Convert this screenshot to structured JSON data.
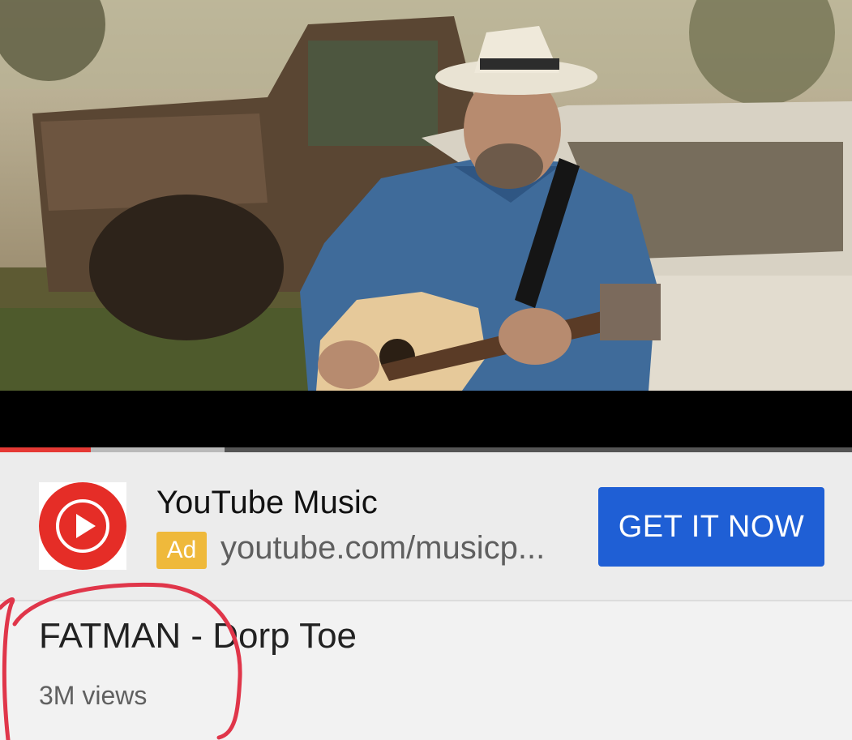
{
  "ad": {
    "title": "YouTube Music",
    "badge": "Ad",
    "url": "youtube.com/musicp...",
    "cta_label": "GET IT NOW"
  },
  "video": {
    "title": "FATMAN - Dorp Toe",
    "views": "3M views",
    "progress_played_fraction": 0.107,
    "progress_buffered_fraction": 0.264
  },
  "colors": {
    "progress_played": "#e53935",
    "cta_background": "#1f5fd5",
    "ad_badge": "#efb93b",
    "logo_red": "#e52d27",
    "annotation_circle": "#e0364a"
  },
  "icons": {
    "ad_logo": "youtube-music-play-icon"
  }
}
